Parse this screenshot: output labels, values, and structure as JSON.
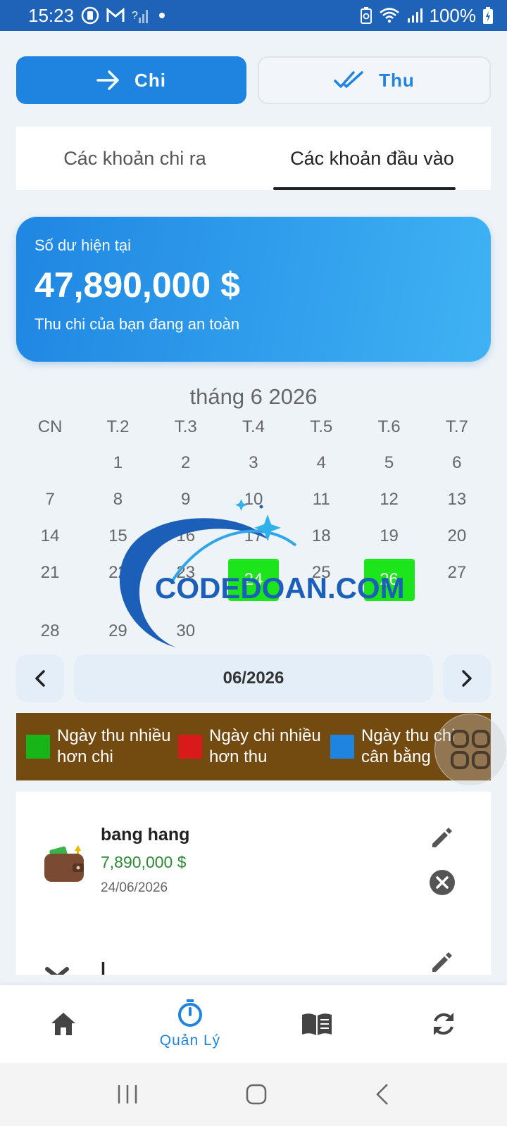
{
  "status_bar": {
    "time": "15:23",
    "battery": "100%",
    "icons": [
      "sync-icon",
      "gmail-icon",
      "no-signal-icon",
      "dot-icon",
      "battery-saver-icon",
      "wifi-icon",
      "signal-icon",
      "battery-charging-icon"
    ]
  },
  "toggle": {
    "expense_label": "Chi",
    "income_label": "Thu",
    "expense_icon": "arrow-right-icon",
    "income_icon": "double-check-icon"
  },
  "tabs": {
    "expenses": "Các khoản chi ra",
    "income": "Các khoản đầu vào",
    "selected": "income"
  },
  "balance": {
    "label": "Số dư hiện tại",
    "amount": "47,890,000 $",
    "note": "Thu chi của bạn đang an toàn"
  },
  "calendar": {
    "title": "tháng 6 2026",
    "weekdays": [
      "CN",
      "T.2",
      "T.3",
      "T.4",
      "T.5",
      "T.6",
      "T.7"
    ],
    "weeks": [
      [
        "",
        "1",
        "2",
        "3",
        "4",
        "5",
        "6"
      ],
      [
        "7",
        "8",
        "9",
        "10",
        "11",
        "12",
        "13"
      ],
      [
        "14",
        "15",
        "16",
        "17",
        "18",
        "19",
        "20"
      ],
      [
        "21",
        "22",
        "23",
        "24",
        "25",
        "26",
        "27"
      ],
      [
        "28",
        "29",
        "30",
        "",
        "",
        "",
        ""
      ]
    ],
    "highlighted_income_days": [
      "24",
      "26"
    ],
    "highlight_color": "#1ce51c"
  },
  "watermark": {
    "text": "CODEDOAN.COM"
  },
  "month_nav": {
    "label": "06/2026",
    "prev_icon": "chevron-left-icon",
    "next_icon": "chevron-right-icon"
  },
  "legend": {
    "items": [
      {
        "color": "#17b517",
        "label": "Ngày thu nhiều hơn chi"
      },
      {
        "color": "#d81a1a",
        "label": "Ngày chi nhiều hơn thu"
      },
      {
        "color": "#1f84e0",
        "label": "Ngày thu chi cân bằng"
      }
    ],
    "background": "#734b11"
  },
  "transactions": [
    {
      "name": "bang hang",
      "amount": "7,890,000 $",
      "date": "24/06/2026",
      "icon": "wallet-icon"
    },
    {
      "name": "l",
      "amount": "",
      "date": "",
      "icon": "tools-icon"
    }
  ],
  "bottom_nav": {
    "items": [
      {
        "icon": "home-icon",
        "label": ""
      },
      {
        "icon": "stopwatch-icon",
        "label": "Quản Lý"
      },
      {
        "icon": "book-icon",
        "label": ""
      },
      {
        "icon": "refresh-icon",
        "label": ""
      }
    ],
    "active": 1,
    "accent": "#1f84e0"
  }
}
